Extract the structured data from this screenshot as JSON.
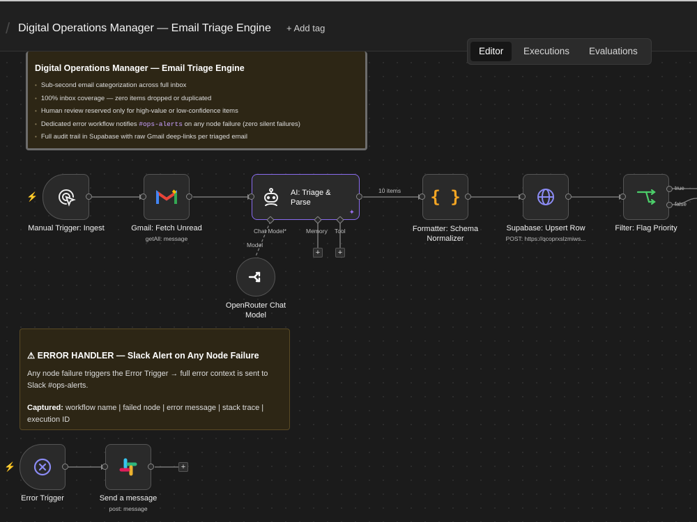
{
  "header": {
    "title": "Digital Operations Manager — Email Triage Engine",
    "add_tag": "+ Add tag",
    "tabs": [
      "Editor",
      "Executions",
      "Evaluations"
    ],
    "active_tab": "Editor"
  },
  "sticky_note_main": {
    "title": "Digital Operations Manager — Email Triage Engine",
    "bullets": [
      "Sub-second email categorization across full inbox",
      "100% inbox coverage — zero items dropped or duplicated",
      "Human review reserved only for high-value or low-confidence items",
      "Full audit trail in Supabase with raw Gmail deep-links per triaged email"
    ],
    "error_bullet_prefix": "Dedicated error workflow notifies",
    "error_bullet_code": "#ops-alerts",
    "error_bullet_suffix": "on any node failure (zero silent failures)"
  },
  "sticky_note_error": {
    "title": "⚠ ERROR HANDLER — Slack Alert on Any Node Failure",
    "body": "Any node failure triggers the Error Trigger → full error context is sent to Slack #ops-alerts.",
    "captured_label": "Captured:",
    "captured_text": "workflow name | failed node | error message | stack trace | execution ID"
  },
  "nodes": {
    "manual_trigger": {
      "name": "Manual Trigger: Ingest"
    },
    "gmail": {
      "name": "Gmail: Fetch Unread",
      "subtitle": "getAll: message"
    },
    "ai_triage": {
      "name_line1": "AI: Triage &",
      "name_line2": "Parse",
      "ports": [
        "Chat Model*",
        "Memory",
        "Tool"
      ]
    },
    "openrouter": {
      "name_line1": "OpenRouter Chat",
      "name_line2": "Model",
      "edge_label": "Model"
    },
    "formatter": {
      "name_line1": "Formatter: Schema",
      "name_line2": "Normalizer"
    },
    "supabase": {
      "name": "Supabase: Upsert Row",
      "subtitle": "POST: https://qcoprxslzmiws..."
    },
    "filter": {
      "name": "Filter: Flag Priority",
      "out_true": "true",
      "out_false": "false"
    },
    "error_trigger": {
      "name": "Error Trigger"
    },
    "slack": {
      "name": "Send a message",
      "subtitle": "post: message"
    }
  },
  "connections": {
    "items_label": "10 items"
  },
  "colors": {
    "canvas": "#1b1b1b",
    "node_bg": "#2a2a2a",
    "ai_border": "#8a6cf0",
    "note_bg": "#2d2615",
    "trigger_bolt": "#f07a3a",
    "formatter_icon": "#f5a623",
    "supabase_icon": "#8c8cf5",
    "filter_icon": "#4ccf6a",
    "error_icon": "#8c8cf5"
  }
}
